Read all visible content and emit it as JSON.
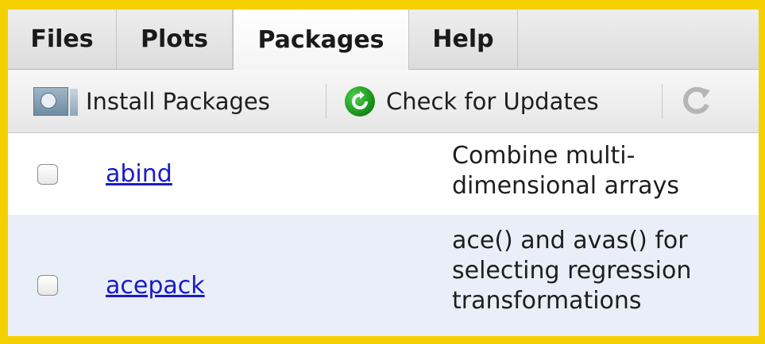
{
  "tabs": [
    {
      "label": "Files"
    },
    {
      "label": "Plots"
    },
    {
      "label": "Packages",
      "active": true
    },
    {
      "label": "Help"
    }
  ],
  "toolbar": {
    "install_label": "Install Packages",
    "update_label": "Check for Updates",
    "install_icon": "install-packages-icon",
    "update_icon": "check-updates-icon",
    "refresh_icon": "refresh-icon"
  },
  "packages": [
    {
      "name": "abind",
      "description_lines": [
        "Combine multi-",
        "dimensional arrays"
      ],
      "checked": false
    },
    {
      "name": "acepack",
      "description_lines": [
        "ace() and avas() for",
        "selecting regression",
        "transformations"
      ],
      "checked": false
    }
  ],
  "colors": {
    "frame_border": "#f5d000",
    "link": "#1a1ac8",
    "alt_row": "#e9eef8",
    "update_green": "#1f9a1f"
  }
}
